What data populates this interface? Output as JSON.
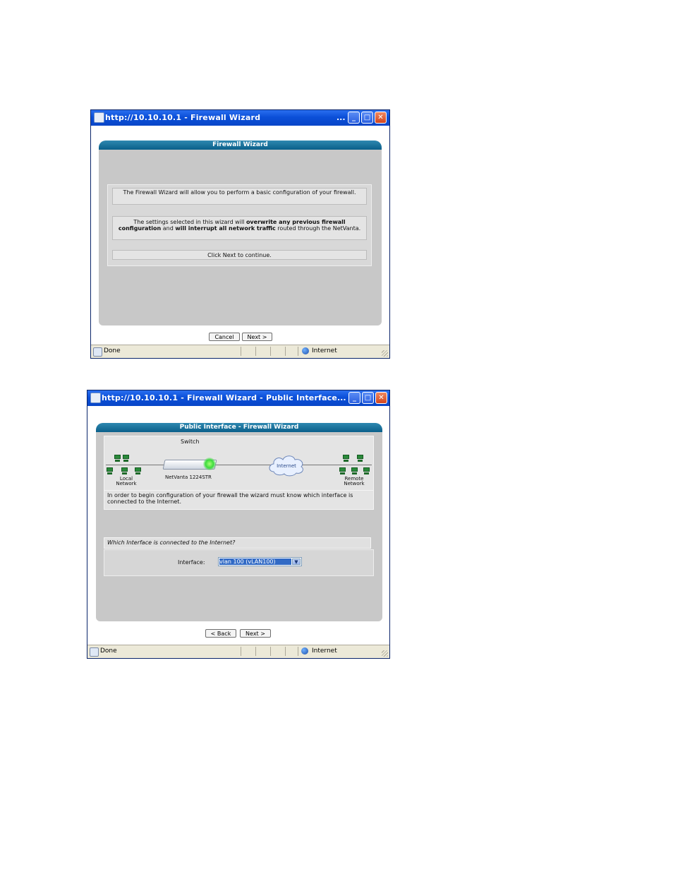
{
  "window1": {
    "title": "http://10.10.10.1 - Firewall Wizard",
    "title_ellipsis": "...",
    "panel_title": "Firewall Wizard",
    "msg1": "The Firewall Wizard will allow you to perform a basic configuration of your firewall.",
    "msg2_a": "The settings selected in this wizard will ",
    "msg2_b": "overwrite any previous firewall configuration",
    "msg2_c": " and ",
    "msg2_d": "will interrupt all network traffic",
    "msg2_e": " routed through the NetVanta.",
    "msg3": "Click Next to continue.",
    "cancel_label": "Cancel",
    "next_label": "Next >",
    "status_text": "Done",
    "zone_text": "Internet"
  },
  "window2": {
    "title": "http://10.10.10.1 - Firewall Wizard - Public Interface",
    "title_ellipsis": "...",
    "panel_title": "Public Interface - Firewall Wizard",
    "switch_label": "Switch",
    "local_network_label": "Local Network",
    "device_label": "NetVanta 1224STR",
    "internet_label": "Internet",
    "remote_network_label": "Remote Network",
    "info_text": "In order to begin configuration of your firewall the wizard must know which interface is connected to the Internet.",
    "question": "Which Interface is connected to the Internet?",
    "interface_label": "Interface:",
    "interface_value": "vlan 100 (vLAN100)",
    "back_label": "< Back",
    "next_label": "Next >",
    "status_text": "Done",
    "zone_text": "Internet"
  },
  "colors": {
    "titlebar": "#0b4fd8",
    "panel_header": "#0a5f8a",
    "panel_body": "#c8c8c8",
    "statusbar": "#ece9d8",
    "link_led": "#3cdc3c"
  },
  "icons": [
    "ie-page-icon",
    "minimize-icon",
    "maximize-icon",
    "close-icon",
    "globe-icon",
    "resize-grip-icon",
    "pc-icon",
    "cloud-icon",
    "switch-device-icon",
    "chevron-down-icon"
  ]
}
